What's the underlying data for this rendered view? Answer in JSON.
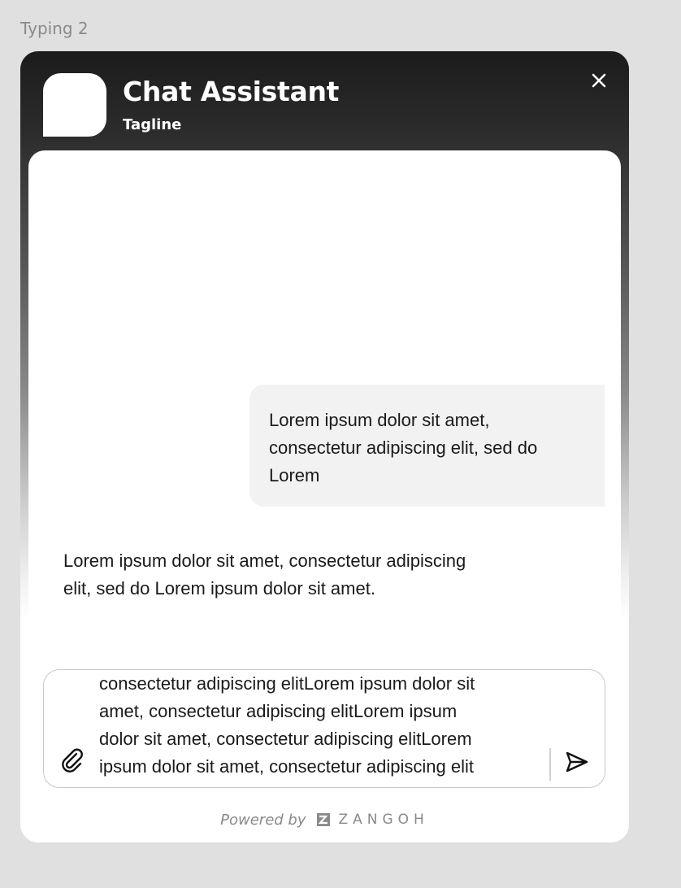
{
  "frame_label": "Typing 2",
  "header": {
    "title": "Chat Assistant",
    "tagline": "Tagline"
  },
  "messages": {
    "user_message": "Lorem ipsum dolor sit amet, consectetur adipiscing elit, sed do Lorem",
    "bot_message": "Lorem ipsum dolor sit amet, consectetur adipiscing elit, sed do Lorem ipsum dolor sit amet."
  },
  "composer": {
    "value": "consectetur adipiscing elitLorem ipsum dolor sit\namet, consectetur adipiscing elitLorem ipsum\ndolor sit amet, consectetur adipiscing elitLorem\nipsum dolor sit amet, consectetur adipiscing elit"
  },
  "footer": {
    "powered_by": "Powered by",
    "brand": "ZANGOH"
  },
  "icons": {
    "close": "close-icon",
    "attach": "paperclip-icon",
    "send": "send-icon",
    "brand_logo": "zangoh-logo-icon"
  },
  "colors": {
    "header_dark": "#1b1b1b",
    "bubble_bg": "#f2f2f2",
    "text": "#1a1a1a",
    "muted": "#8a8a8a"
  }
}
